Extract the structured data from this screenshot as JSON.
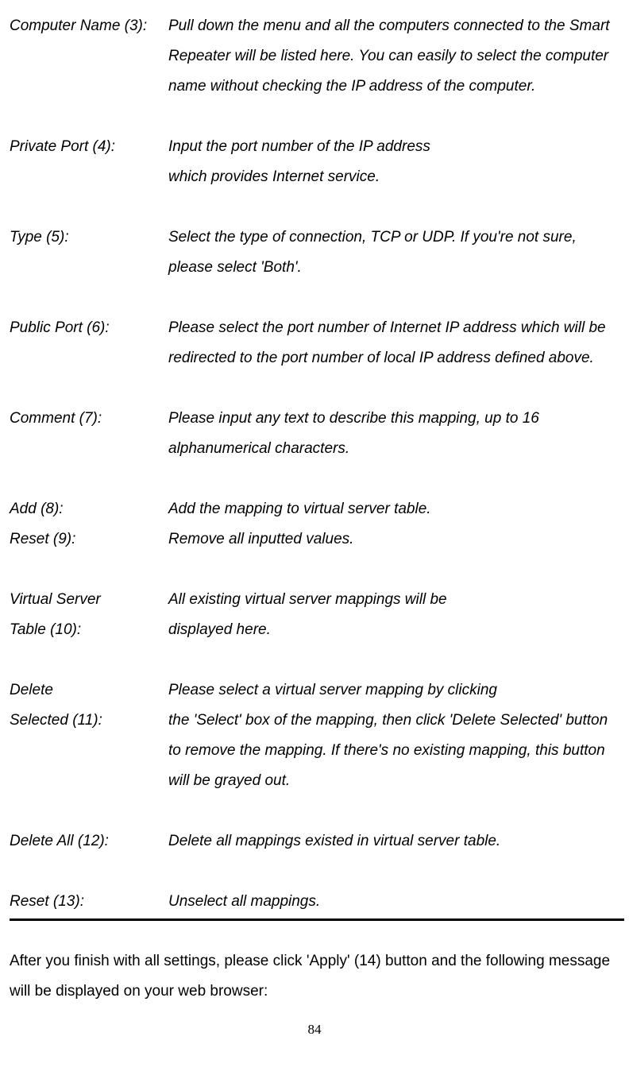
{
  "definitions": {
    "item1": {
      "term": "Computer Name (3):",
      "desc": "Pull down the menu and all the computers connected to the Smart Repeater will be listed here. You can easily to select the computer name without checking the IP address of the computer."
    },
    "item2": {
      "term": "Private Port (4):",
      "desc_line1": "Input the port number of the IP address",
      "desc_line2": "which provides Internet service."
    },
    "item3": {
      "term": "Type (5):",
      "desc": "Select the type of connection, TCP or UDP. If you're not sure, please select 'Both'."
    },
    "item4": {
      "term": "Public Port (6):",
      "desc": "Please select the port number of Internet IP address which will be redirected to the port number of local IP address defined above."
    },
    "item5": {
      "term": "Comment (7):",
      "desc": "Please input any text to describe this mapping, up to 16 alphanumerical characters."
    },
    "item6": {
      "term": "Add (8):",
      "desc": "Add the mapping to virtual server table."
    },
    "item7": {
      "term": "Reset (9):",
      "desc": "Remove all inputted values."
    },
    "item8": {
      "term_line1": "Virtual Server",
      "term_line2": "Table (10):",
      "desc_line1": "All existing virtual server mappings will be",
      "desc_line2": "displayed here."
    },
    "item9": {
      "term_line1": "Delete",
      "term_line2": "Selected (11):",
      "desc_line1": "Please select a virtual server mapping by clicking",
      "desc_line2": "the 'Select' box of the mapping, then click 'Delete",
      "desc_rest": "Selected' button to remove the mapping. If there's no existing mapping, this button will be grayed out."
    },
    "item10": {
      "term": "Delete All (12):",
      "desc": "Delete all mappings existed in virtual server table."
    },
    "item11": {
      "term": "Reset (13):",
      "desc": "Unselect all mappings."
    }
  },
  "afterText": "After you finish with all settings, please click 'Apply' (14) button and the following message will be displayed on your web browser:",
  "pageNumber": "84"
}
